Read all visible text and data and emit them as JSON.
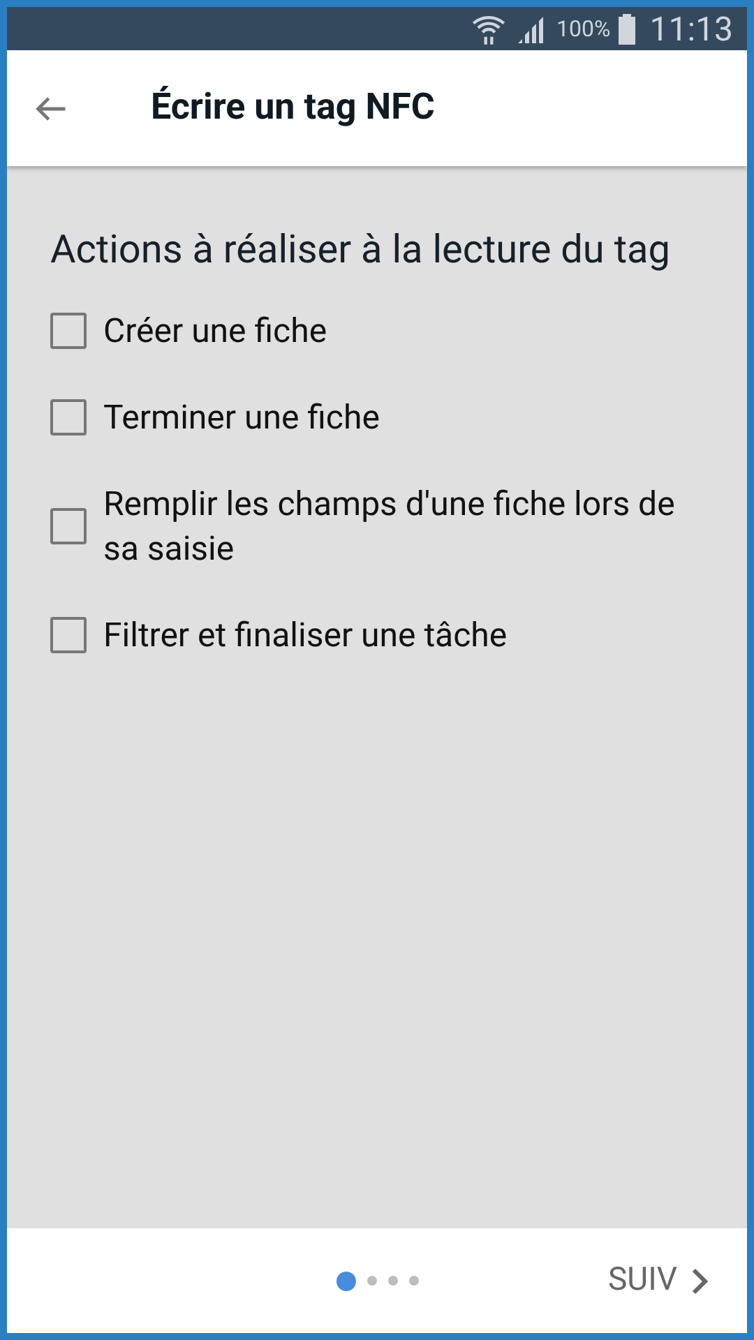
{
  "status_bar": {
    "battery": "100%",
    "time": "11:13"
  },
  "app_bar": {
    "title": "Écrire un tag NFC"
  },
  "section_title": "Actions à réaliser à la lecture du tag",
  "options": [
    {
      "label": "Créer une fiche",
      "checked": false
    },
    {
      "label": "Terminer une fiche",
      "checked": false
    },
    {
      "label": "Remplir les champs d'une fiche lors de sa saisie",
      "checked": false
    },
    {
      "label": "Filtrer et finaliser une tâche",
      "checked": false
    }
  ],
  "pager": [
    {
      "selected": true
    },
    {
      "selected": false
    },
    {
      "selected": false
    },
    {
      "selected": false
    }
  ],
  "next_button": {
    "label": "SUIV"
  }
}
